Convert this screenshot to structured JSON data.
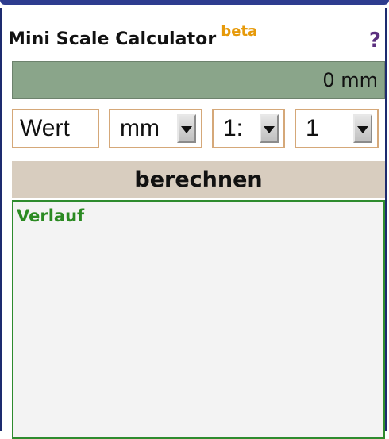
{
  "app": {
    "title": "Mini Scale Calculator",
    "badge": "beta",
    "help": "?"
  },
  "result": {
    "value": "0 mm"
  },
  "inputs": {
    "value": "Wert",
    "unit": "mm",
    "scale_prefix": "1:",
    "ratio": "1"
  },
  "actions": {
    "calculate": "berechnen"
  },
  "history": {
    "title": "Verlauf"
  },
  "colors": {
    "frame": "#1d2b6f",
    "result_bg": "#8aa58a",
    "button_bg": "#d8cdbf",
    "history_border": "#2e8b2e",
    "history_title": "#2b8a22",
    "badge": "#e69a0a"
  }
}
